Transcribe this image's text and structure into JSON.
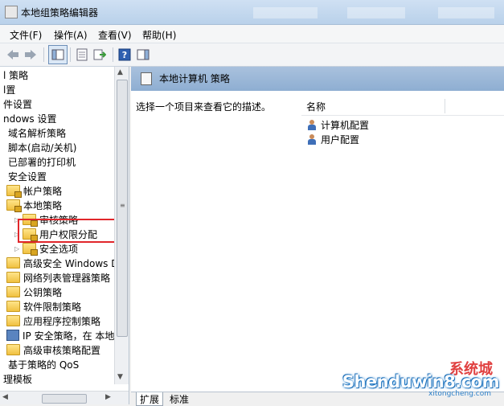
{
  "window": {
    "title": "本地组策略编辑器"
  },
  "menu": [
    "文件(F)",
    "操作(A)",
    "查看(V)",
    "帮助(H)"
  ],
  "tree": [
    {
      "label": "l 策略",
      "indent": 0,
      "icon": "none",
      "expander": ""
    },
    {
      "label": "l置",
      "indent": 0,
      "icon": "none",
      "expander": ""
    },
    {
      "label": "件设置",
      "indent": 0,
      "icon": "none",
      "expander": ""
    },
    {
      "label": "ndows 设置",
      "indent": 0,
      "icon": "none",
      "expander": ""
    },
    {
      "label": "域名解析策略",
      "indent": 1,
      "icon": "none",
      "expander": ""
    },
    {
      "label": "脚本(启动/关机)",
      "indent": 1,
      "icon": "none",
      "expander": ""
    },
    {
      "label": "已部署的打印机",
      "indent": 1,
      "icon": "none",
      "expander": ""
    },
    {
      "label": "安全设置",
      "indent": 1,
      "icon": "none",
      "expander": ""
    },
    {
      "label": "帐户策略",
      "indent": 2,
      "icon": "folder-lock",
      "expander": ""
    },
    {
      "label": "本地策略",
      "indent": 2,
      "icon": "folder-lock",
      "expander": ""
    },
    {
      "label": "审核策略",
      "indent": 3,
      "icon": "folder-lock",
      "expander": "▷"
    },
    {
      "label": "用户权限分配",
      "indent": 3,
      "icon": "folder-lock",
      "expander": "▷"
    },
    {
      "label": "安全选项",
      "indent": 3,
      "icon": "folder-lock",
      "expander": "▷"
    },
    {
      "label": "高级安全 Windows D",
      "indent": 2,
      "icon": "folder",
      "expander": ""
    },
    {
      "label": "网络列表管理器策略",
      "indent": 2,
      "icon": "folder",
      "expander": ""
    },
    {
      "label": "公钥策略",
      "indent": 2,
      "icon": "folder",
      "expander": ""
    },
    {
      "label": "软件限制策略",
      "indent": 2,
      "icon": "folder",
      "expander": ""
    },
    {
      "label": "应用程序控制策略",
      "indent": 2,
      "icon": "folder",
      "expander": ""
    },
    {
      "label": "IP 安全策略，在 本地",
      "indent": 2,
      "icon": "monitor",
      "expander": ""
    },
    {
      "label": "高级审核策略配置",
      "indent": 2,
      "icon": "folder",
      "expander": ""
    },
    {
      "label": "基于策略的 QoS",
      "indent": 1,
      "icon": "none",
      "expander": ""
    },
    {
      "label": "理模板",
      "indent": 0,
      "icon": "none",
      "expander": ""
    }
  ],
  "right": {
    "header": "本地计算机 策略",
    "description": "选择一个项目来查看它的描述。",
    "column": "名称",
    "items": [
      "计算机配置",
      "用户配置"
    ]
  },
  "tabs": [
    "扩展",
    "标准"
  ],
  "watermark": {
    "main": "Shenduwin8.com",
    "sub": "xitongcheng.com",
    "logo": "系统城"
  }
}
